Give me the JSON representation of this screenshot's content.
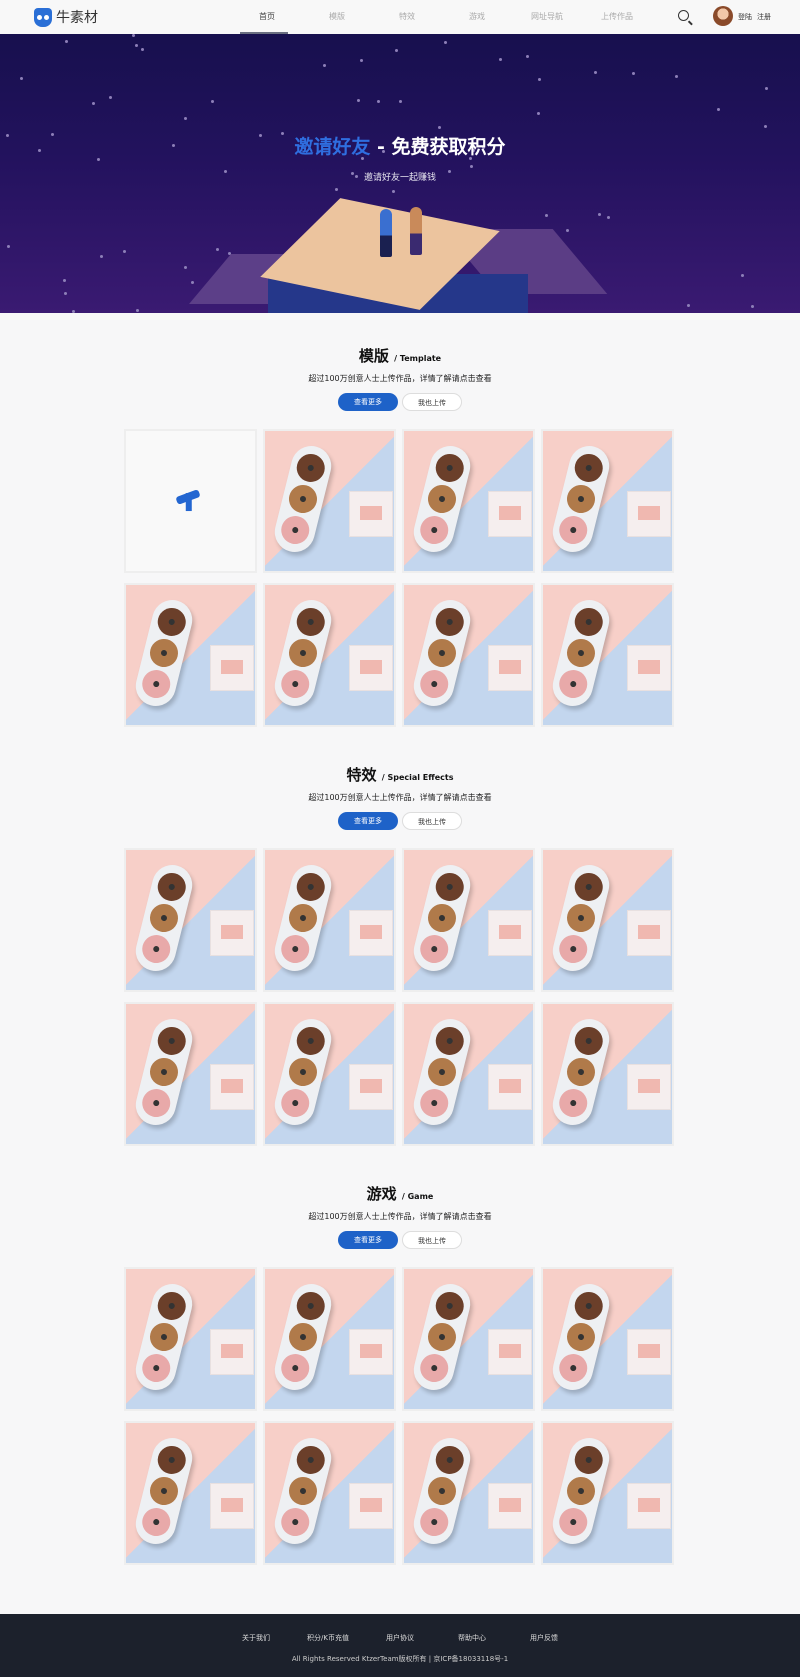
{
  "header": {
    "logo_text": "牛素材",
    "nav": [
      {
        "label": "首页",
        "active": true
      },
      {
        "label": "模版"
      },
      {
        "label": "特效"
      },
      {
        "label": "游戏"
      },
      {
        "label": "网址导航"
      },
      {
        "label": "上传作品"
      }
    ],
    "login": "登陆",
    "register": "注册"
  },
  "hero": {
    "title_highlight": "邀请好友",
    "title_rest": " - 免费获取积分",
    "subtitle": "邀请好友一起赚钱",
    "accent": "#2f6ee0"
  },
  "sections": [
    {
      "title": "模版",
      "subtitle": "/ Template",
      "desc": "超过100万创意人士上传作品，详情了解请点击查看",
      "more": "查看更多",
      "upload": "我也上传",
      "cards": [
        "loading",
        "donut",
        "donut",
        "donut",
        "donut",
        "donut",
        "donut",
        "donut"
      ]
    },
    {
      "title": "特效",
      "subtitle": "/ Special Effects",
      "desc": "超过100万创意人士上传作品，详情了解请点击查看",
      "more": "查看更多",
      "upload": "我也上传",
      "cards": [
        "donut",
        "donut",
        "donut",
        "donut",
        "donut",
        "donut",
        "donut",
        "donut"
      ]
    },
    {
      "title": "游戏",
      "subtitle": "/ Game",
      "desc": "超过100万创意人士上传作品，详情了解请点击查看",
      "more": "查看更多",
      "upload": "我也上传",
      "cards": [
        "donut",
        "donut",
        "donut",
        "donut",
        "donut",
        "donut",
        "donut",
        "donut"
      ]
    }
  ],
  "footer": {
    "links": [
      "关于我们",
      "积分/K币充值",
      "用户协议",
      "帮助中心",
      "用户反馈"
    ],
    "copyright": "All Rights Reserved KtzerTeam版权所有 | 京ICP备18033118号-1"
  },
  "colors": {
    "primary": "#1e62c8",
    "footer_bg": "#1c212c",
    "hero_bg": "#23125e"
  }
}
